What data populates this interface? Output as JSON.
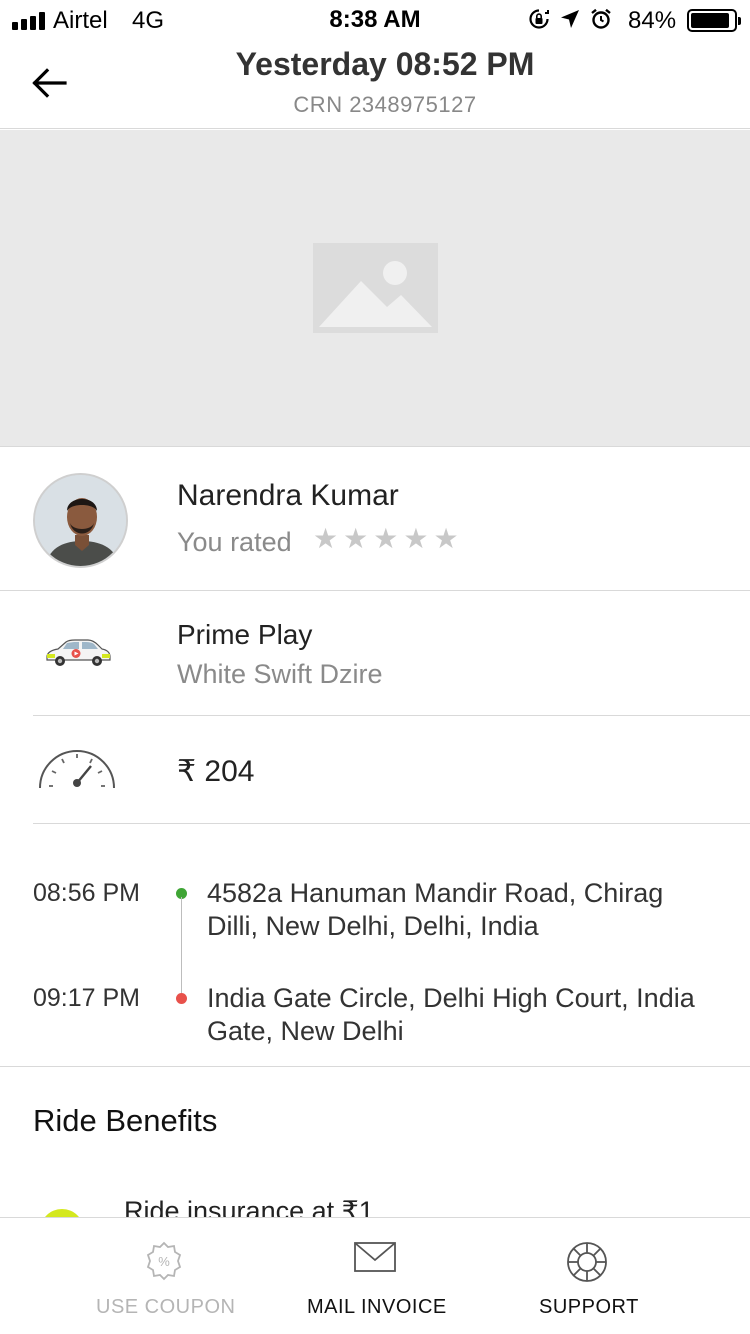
{
  "status_bar": {
    "carrier": "Airtel",
    "network": "4G",
    "time": "8:38 AM",
    "battery_percent": "84%",
    "battery_level": 0.84,
    "icons": [
      "orientation-lock-icon",
      "location-arrow-icon",
      "alarm-icon",
      "battery-icon"
    ]
  },
  "header": {
    "title": "Yesterday 08:52 PM",
    "crn": "CRN 2348975127",
    "back_icon": "back-arrow-icon"
  },
  "map": {
    "placeholder_icon": "image-placeholder-icon"
  },
  "driver": {
    "name": "Narendra Kumar",
    "rated_label": "You rated",
    "stars_total": 5,
    "stars_filled": 0
  },
  "car": {
    "category": "Prime Play",
    "model": "White Swift Dzire",
    "icon": "car-icon"
  },
  "fare": {
    "amount": "₹ 204",
    "icon": "speedometer-icon"
  },
  "trip": {
    "pickup": {
      "time": "08:56 PM",
      "address": "4582a Hanuman Mandir Road, Chirag Dilli, New Delhi, Delhi, India",
      "dot_color": "#3fa535"
    },
    "drop": {
      "time": "09:17 PM",
      "address": "India Gate Circle, Delhi High Court, India Gate, New Delhi",
      "dot_color": "#e8514b"
    }
  },
  "benefits": {
    "title": "Ride Benefits",
    "items": [
      {
        "label": "Ride insurance at ₹1",
        "icon_color": "#d4e81f"
      }
    ]
  },
  "bottom_bar": {
    "items": [
      {
        "label": "USE COUPON",
        "icon": "coupon-icon",
        "enabled": false
      },
      {
        "label": "MAIL INVOICE",
        "icon": "mail-icon",
        "enabled": true
      },
      {
        "label": "SUPPORT",
        "icon": "support-icon",
        "enabled": true
      }
    ]
  },
  "colors": {
    "text_primary": "#222222",
    "text_secondary": "#8a8a8a",
    "divider": "#d9d9d9",
    "map_bg": "#e9e9e9",
    "disabled": "#b5b5b5"
  }
}
